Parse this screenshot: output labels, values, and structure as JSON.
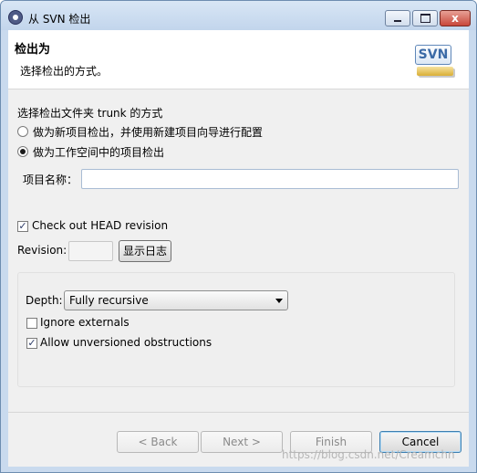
{
  "window": {
    "title": "从 SVN 检出",
    "icons": {
      "app": "eclipse-icon",
      "minimize": "minimize-icon",
      "maximize": "maximize-icon",
      "close": "close-icon"
    },
    "close_glyph": "x"
  },
  "header": {
    "title": "检出为",
    "description": "选择检出的方式。",
    "logo_text": "SVN"
  },
  "options": {
    "heading": "选择检出文件夹 trunk 的方式",
    "radio_new_project": "做为新项目检出，并使用新建项目向导进行配置",
    "radio_workspace": "做为工作空间中的项目检出",
    "selected": "radio_workspace",
    "project_name_label": "项目名称：",
    "project_name_value": ""
  },
  "revision": {
    "checkout_head_label": "Check out HEAD revision",
    "checkout_head_checked": true,
    "revision_label": "Revision:",
    "revision_value": "",
    "show_log_button": "显示日志"
  },
  "advanced": {
    "depth_label": "Depth:",
    "depth_value": "Fully recursive",
    "ignore_externals_label": "Ignore externals",
    "ignore_externals_checked": false,
    "allow_unversioned_label": "Allow unversioned obstructions",
    "allow_unversioned_checked": true,
    "check_glyph": "✓"
  },
  "footer": {
    "back": "< Back",
    "next": "Next >",
    "finish": "Finish",
    "cancel": "Cancel"
  },
  "watermark": "https://blog.csdn.net/Creamchn"
}
